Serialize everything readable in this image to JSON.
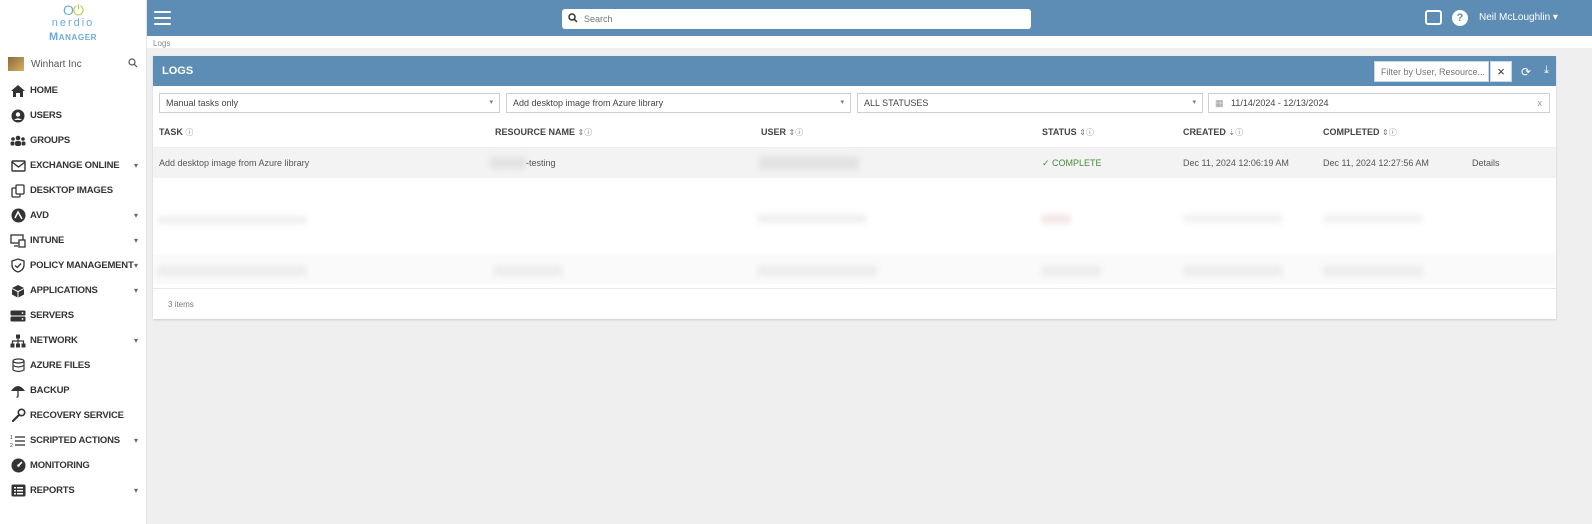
{
  "logo": {
    "word": "nerdio",
    "product": "Manager"
  },
  "tenant": {
    "name": "Winhart Inc"
  },
  "sidebar": {
    "items": [
      {
        "label": "HOME",
        "icon": "home-icon",
        "caret": false
      },
      {
        "label": "USERS",
        "icon": "user-icon",
        "caret": false
      },
      {
        "label": "GROUPS",
        "icon": "users-icon",
        "caret": false
      },
      {
        "label": "EXCHANGE ONLINE",
        "icon": "envelope-icon",
        "caret": true
      },
      {
        "label": "DESKTOP IMAGES",
        "icon": "copy-icon",
        "caret": false
      },
      {
        "label": "AVD",
        "icon": "avd-icon",
        "caret": true
      },
      {
        "label": "INTUNE",
        "icon": "devices-icon",
        "caret": true
      },
      {
        "label": "POLICY MANAGEMENT",
        "icon": "shield-icon",
        "caret": true
      },
      {
        "label": "APPLICATIONS",
        "icon": "box-icon",
        "caret": true
      },
      {
        "label": "SERVERS",
        "icon": "server-icon",
        "caret": false
      },
      {
        "label": "NETWORK",
        "icon": "network-icon",
        "caret": true
      },
      {
        "label": "AZURE FILES",
        "icon": "database-icon",
        "caret": false
      },
      {
        "label": "BACKUP",
        "icon": "umbrella-icon",
        "caret": false
      },
      {
        "label": "RECOVERY SERVICE",
        "icon": "wrench-icon",
        "caret": false
      },
      {
        "label": "SCRIPTED ACTIONS",
        "icon": "ordered-list-icon",
        "caret": true
      },
      {
        "label": "MONITORING",
        "icon": "dashboard-icon",
        "caret": false
      },
      {
        "label": "REPORTS",
        "icon": "list-alt-icon",
        "caret": true
      }
    ],
    "caret_glyph": "▾"
  },
  "topbar": {
    "search_placeholder": "Search",
    "user_name": "Neil McLoughlin ▾",
    "help_glyph": "?"
  },
  "breadcrumb": "Logs",
  "panel": {
    "title": "LOGS",
    "filter_placeholder": "Filter by User, Resource...",
    "clear_glyph": "×",
    "refresh_glyph": "⟳",
    "download_glyph": "⤓"
  },
  "filters": {
    "task_type": "Manual tasks only",
    "task_name": "Add desktop image from Azure library",
    "status": "ALL STATUSES",
    "date_range": "11/14/2024 - 12/13/2024",
    "caret": "▾",
    "calendar_glyph": "▦",
    "clear_glyph": "x"
  },
  "table": {
    "columns": [
      {
        "label": "TASK",
        "sort": "",
        "info": "ⓘ"
      },
      {
        "label": "RESOURCE NAME",
        "sort": "⇕",
        "info": "ⓘ"
      },
      {
        "label": "USER",
        "sort": "⇕",
        "info": "ⓘ"
      },
      {
        "label": "STATUS",
        "sort": "⇕",
        "info": "ⓘ"
      },
      {
        "label": "CREATED",
        "sort": "⇣",
        "info": "ⓘ"
      },
      {
        "label": "COMPLETED",
        "sort": "⇕",
        "info": "ⓘ"
      }
    ],
    "rows": [
      {
        "task": "Add desktop image from Azure library",
        "resource": "-testing",
        "status": "✓ COMPLETE",
        "created": "Dec 11, 2024 12:06:19 AM",
        "completed": "Dec 11, 2024 12:27:56 AM",
        "details": "Details"
      }
    ],
    "footer": "3 items"
  },
  "colors": {
    "topbar": "#5d8db4",
    "panel_header": "#5d8db4",
    "background": "#efefef",
    "status_complete": "#4a8a3a"
  }
}
